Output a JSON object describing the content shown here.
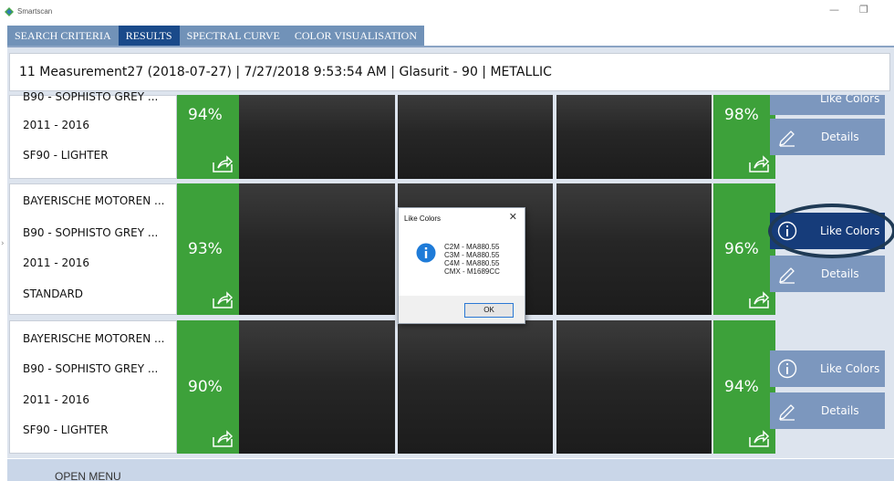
{
  "window": {
    "title": "Smartscan"
  },
  "tabs": [
    {
      "label": "SEARCH CRITERIA",
      "active": false
    },
    {
      "label": "RESULTS",
      "active": true
    },
    {
      "label": "SPECTRAL CURVE",
      "active": false
    },
    {
      "label": "COLOR VISUALISATION",
      "active": false
    }
  ],
  "header": {
    "text": "11 Measurement27 (2018-07-27) | 7/27/2018 9:53:54 AM | Glasurit - 90 | METALLIC"
  },
  "results": [
    {
      "lines": [
        "B90 - SOPHISTO GREY ...",
        "2011 - 2016",
        "SF90 - LIGHTER"
      ],
      "match_left": "94%",
      "match_right": "98%",
      "like_colors_label": "Like Colors",
      "details_label": "Details"
    },
    {
      "lines": [
        "BAYERISCHE MOTOREN ...",
        "B90 - SOPHISTO GREY ...",
        "2011 - 2016",
        "STANDARD"
      ],
      "match_left": "93%",
      "match_right": "96%",
      "like_colors_label": "Like Colors",
      "details_label": "Details"
    },
    {
      "lines": [
        "BAYERISCHE MOTOREN ...",
        "B90 - SOPHISTO GREY ...",
        "2011 - 2016",
        "SF90 - LIGHTER"
      ],
      "match_left": "90%",
      "match_right": "94%",
      "like_colors_label": "Like Colors",
      "details_label": "Details"
    }
  ],
  "dialog": {
    "title": "Like Colors",
    "lines": [
      "C2M - MA880.55",
      "C3M - MA880.55",
      "C4M - MA880.55",
      "CMX - M1689CC"
    ],
    "ok_label": "OK"
  },
  "bottom": {
    "open_menu_label": "OPEN MENU"
  },
  "colors": {
    "match_green": "#3da13a",
    "tab_active": "#1a4a8a",
    "tab_bar": "#7192b8",
    "action_button": "#7c97be",
    "action_button_selected": "#163c7a",
    "highlight_ring": "#1f3a55"
  }
}
